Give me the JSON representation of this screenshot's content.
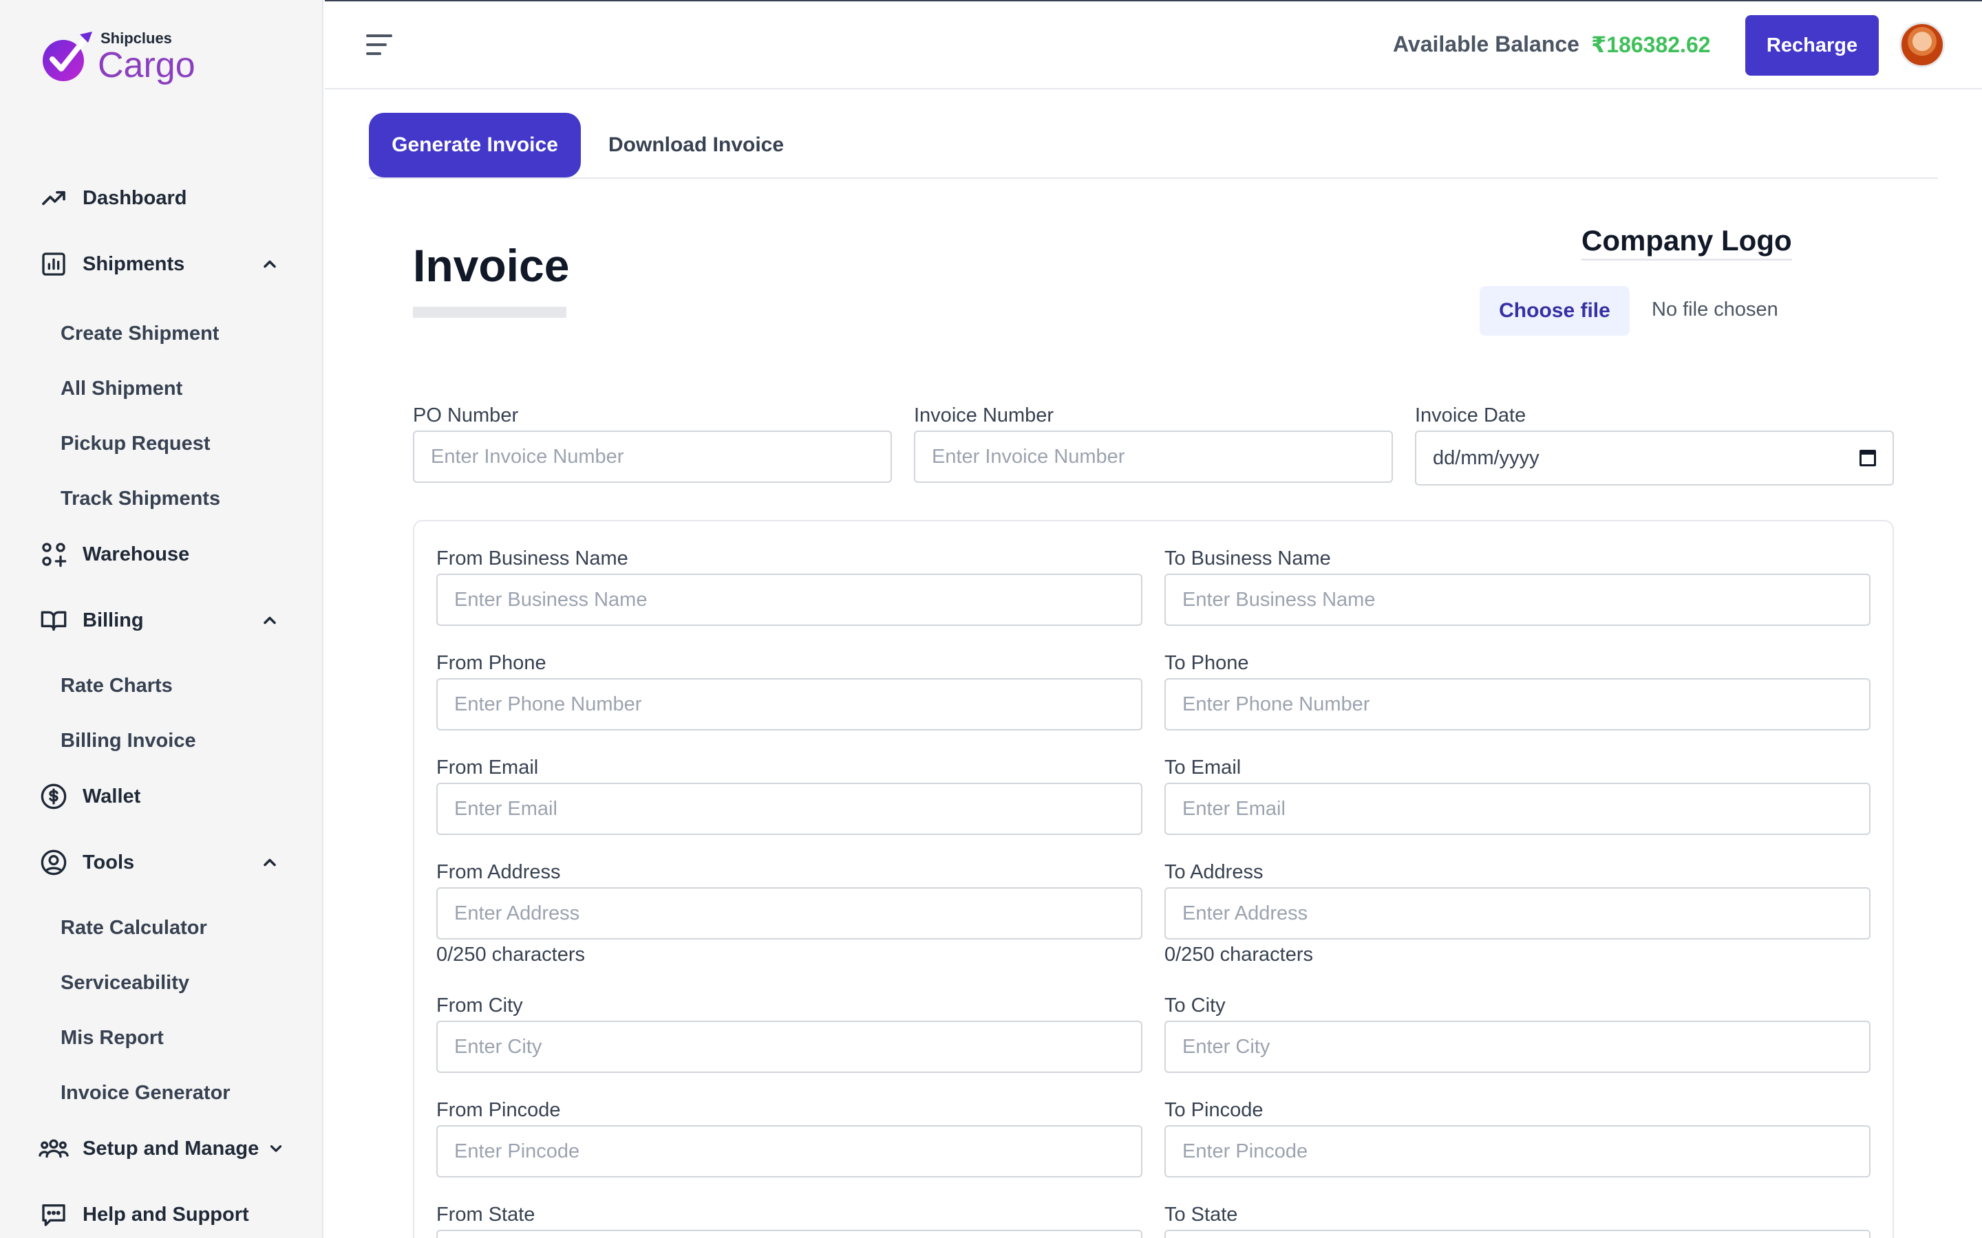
{
  "brand": {
    "small": "Shipclues",
    "big": "Cargo"
  },
  "sidebar": {
    "dashboard": "Dashboard",
    "shipments": "Shipments",
    "shipments_sub": [
      "Create Shipment",
      "All Shipment",
      "Pickup Request",
      "Track Shipments"
    ],
    "warehouse": "Warehouse",
    "billing": "Billing",
    "billing_sub": [
      "Rate Charts",
      "Billing Invoice"
    ],
    "wallet": "Wallet",
    "tools": "Tools",
    "tools_sub": [
      "Rate Calculator",
      "Serviceability",
      "Mis Report",
      "Invoice Generator"
    ],
    "setup": "Setup and Manage",
    "help": "Help and Support"
  },
  "header": {
    "balance_label": "Available Balance",
    "balance_value": "₹186382.62",
    "recharge": "Recharge"
  },
  "tabs": {
    "generate": "Generate Invoice",
    "download": "Download Invoice"
  },
  "invoice": {
    "title": "Invoice",
    "company_logo": "Company Logo",
    "choose_file": "Choose file",
    "file_status": "No file chosen",
    "po_label": "PO Number",
    "po_placeholder": "Enter Invoice Number",
    "inv_num_label": "Invoice Number",
    "inv_num_placeholder": "Enter Invoice Number",
    "date_label": "Invoice Date",
    "date_placeholder": "dd/mm/yyyy"
  },
  "from": {
    "business_label": "From Business Name",
    "business_ph": "Enter Business Name",
    "phone_label": "From Phone",
    "phone_ph": "Enter Phone Number",
    "email_label": "From Email",
    "email_ph": "Enter Email",
    "address_label": "From Address",
    "address_ph": "Enter Address",
    "address_count": "0/250 characters",
    "city_label": "From City",
    "city_ph": "Enter City",
    "pincode_label": "From Pincode",
    "pincode_ph": "Enter Pincode",
    "state_label": "From State"
  },
  "to": {
    "business_label": "To Business Name",
    "business_ph": "Enter Business Name",
    "phone_label": "To Phone",
    "phone_ph": "Enter Phone Number",
    "email_label": "To Email",
    "email_ph": "Enter Email",
    "address_label": "To Address",
    "address_ph": "Enter Address",
    "address_count": "0/250 characters",
    "city_label": "To City",
    "city_ph": "Enter City",
    "pincode_label": "To Pincode",
    "pincode_ph": "Enter Pincode",
    "state_label": "To State"
  },
  "colors": {
    "accent": "#4338ca",
    "balance": "#3fbf5a",
    "logo_purple": "#8b3fbf"
  }
}
